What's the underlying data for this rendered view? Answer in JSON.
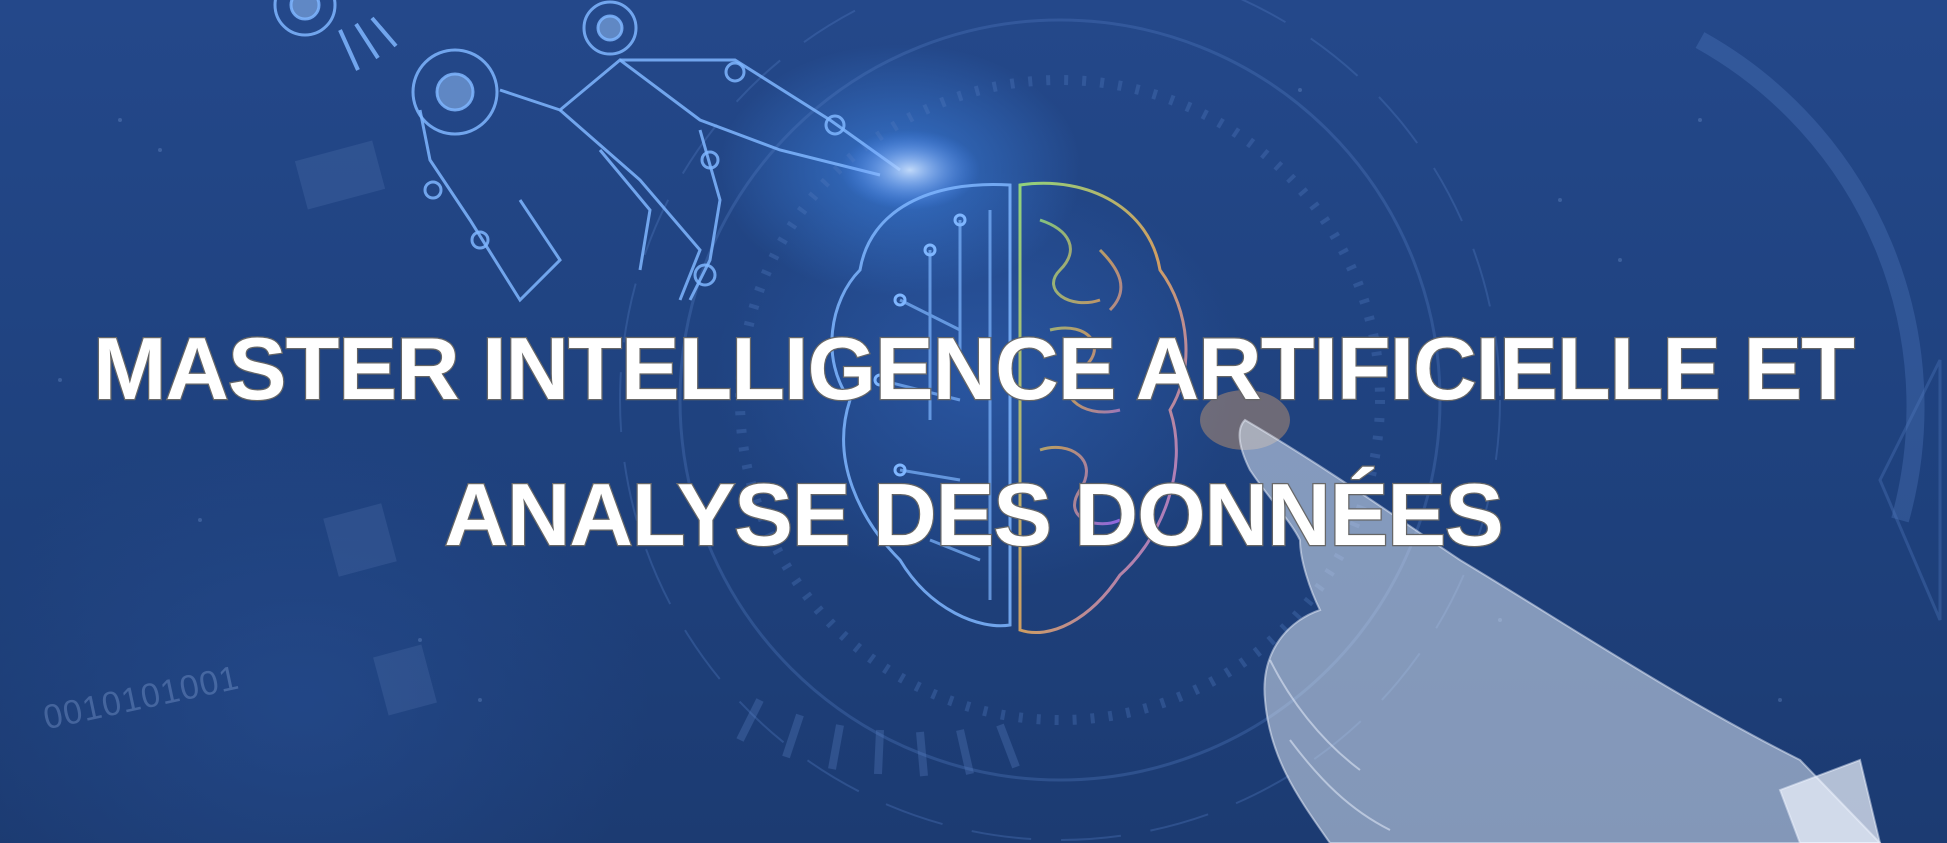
{
  "banner": {
    "title_line1": "MASTER INTELLIGENCE ARTIFICIELLE ET",
    "title_line2": "ANALYSE DES DONNÉES",
    "binary_text": "0010101001"
  },
  "artwork": {
    "robot_hand": "robot-hand-illustration",
    "brain": "circuit-brain-illustration",
    "human_hand": "human-hand-illustration"
  },
  "colors": {
    "background": "#1f427f",
    "title_fill": "#ffffff",
    "title_stroke": "#6f6f6f",
    "circuit_lines": "#6fa9ff",
    "brain_right": "#b98cff"
  }
}
